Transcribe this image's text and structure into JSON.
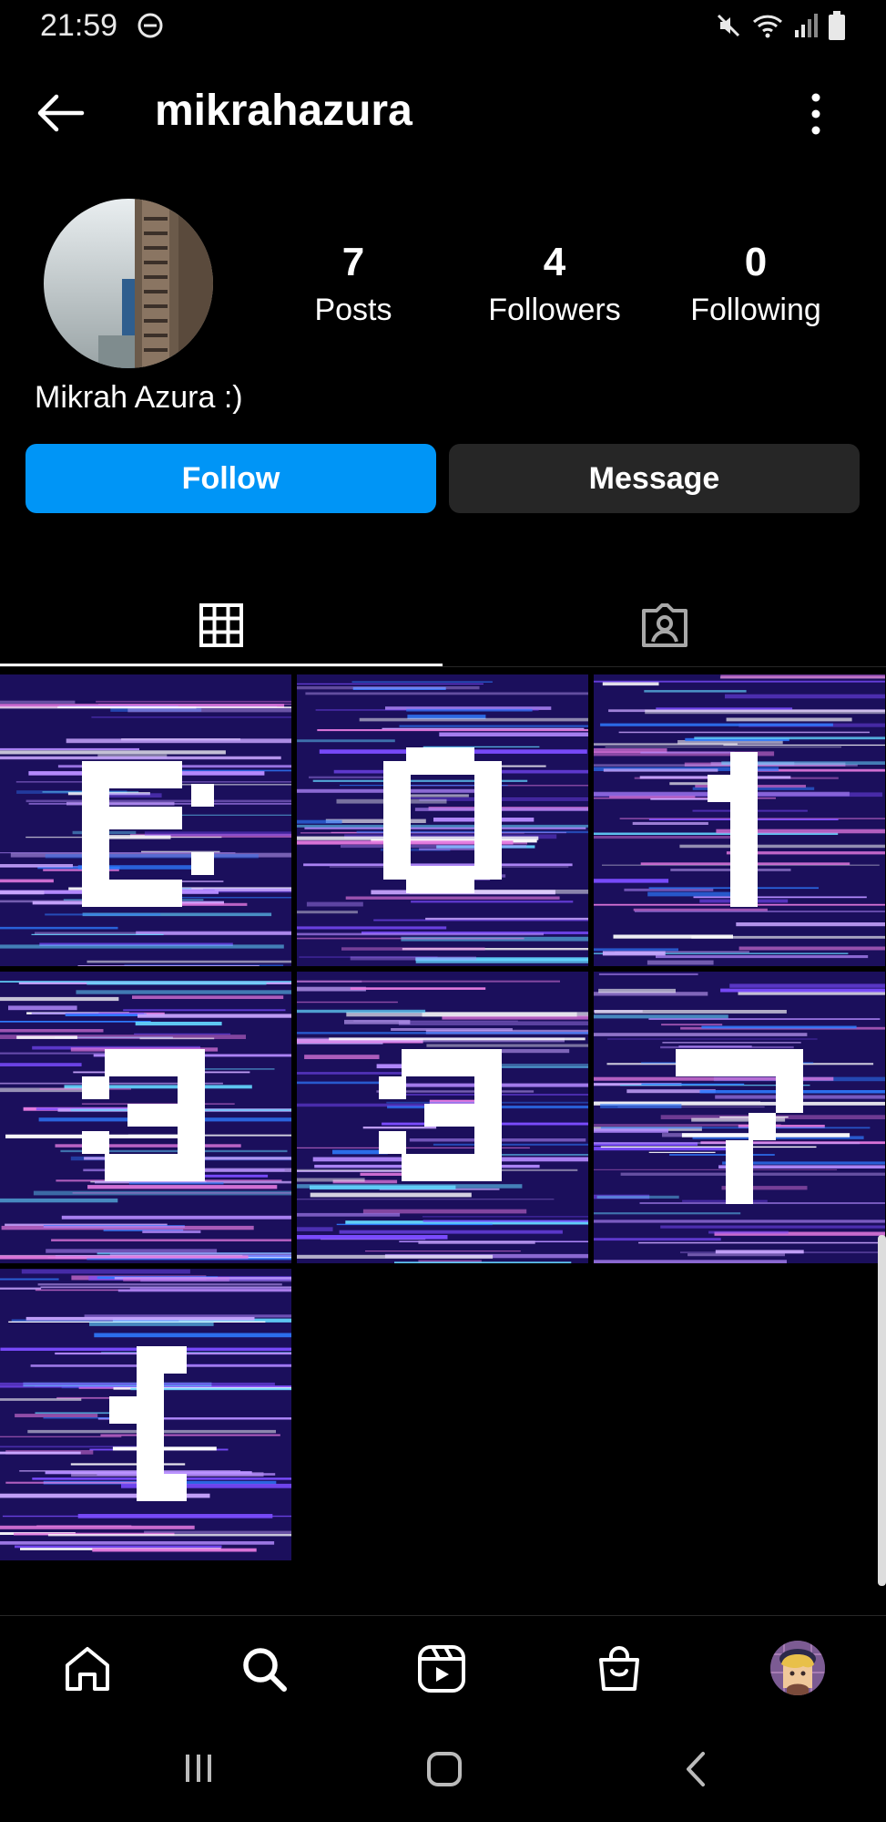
{
  "status_bar": {
    "time": "21:59"
  },
  "profile": {
    "username": "mikrahazura",
    "display_name": "Mikrah Azura :)",
    "stats": [
      {
        "value": "7",
        "label": "Posts"
      },
      {
        "value": "4",
        "label": "Followers"
      },
      {
        "value": "0",
        "label": "Following"
      }
    ]
  },
  "actions": {
    "follow_label": "Follow",
    "message_label": "Message"
  },
  "tabs": [
    {
      "icon": "grid-icon",
      "selected": true
    },
    {
      "icon": "tagged-icon",
      "selected": false
    }
  ],
  "posts": [
    {
      "glyph": "E:"
    },
    {
      "glyph": "0"
    },
    {
      "glyph": "1"
    },
    {
      "glyph": "3"
    },
    {
      "glyph": "3"
    },
    {
      "glyph": "7"
    },
    {
      "glyph": "["
    }
  ],
  "bottom_nav": [
    "home-icon",
    "search-icon",
    "reels-icon",
    "shop-icon",
    "profile-avatar"
  ],
  "colors": {
    "accent": "#0095f6",
    "button_dark": "#262626",
    "post_bg": "#1b0f5c"
  }
}
